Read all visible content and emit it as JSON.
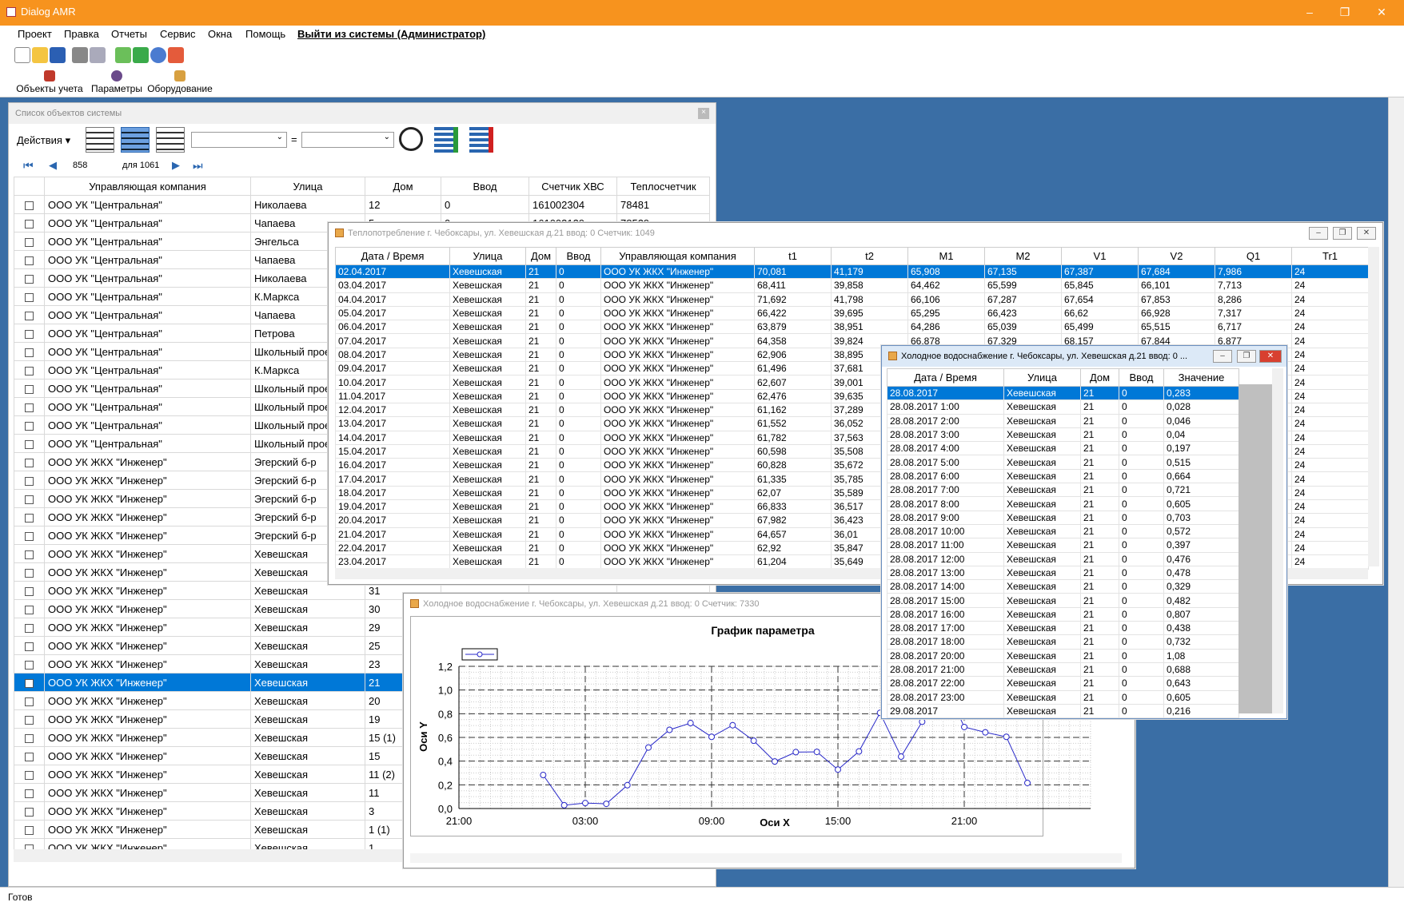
{
  "app": {
    "title": "Dialog AMR",
    "status": "Готов"
  },
  "menu": [
    "Проект",
    "Правка",
    "Отчеты",
    "Сервис",
    "Окна",
    "Помощь",
    "Выйти из системы (Администратор)"
  ],
  "ribbon": [
    "Объекты учета",
    "Параметры",
    "Оборудование"
  ],
  "objects_panel": {
    "title": "Список объектов системы",
    "actions": "Действия",
    "eq": "=",
    "record": "858",
    "of_label": "для 1061",
    "columns": [
      "Управляющая компания",
      "Улица",
      "Дом",
      "Ввод",
      "Счетчик ХВС",
      "Теплосчетчик"
    ],
    "rows": [
      [
        "ООО УК \"Центральная\"",
        "Николаева",
        "12",
        "0",
        "161002304",
        "78481"
      ],
      [
        "ООО УК \"Центральная\"",
        "Чапаева",
        "5",
        "0",
        "161003129",
        "78529"
      ],
      [
        "ООО УК \"Центральная\"",
        "Энгельса",
        "",
        "",
        "",
        ""
      ],
      [
        "ООО УК \"Центральная\"",
        "Чапаева",
        "",
        "",
        "",
        ""
      ],
      [
        "ООО УК \"Центральная\"",
        "Николаева",
        "",
        "",
        "",
        ""
      ],
      [
        "ООО УК \"Центральная\"",
        "К.Маркса",
        "",
        "",
        "",
        ""
      ],
      [
        "ООО УК \"Центральная\"",
        "Чапаева",
        "",
        "",
        "",
        ""
      ],
      [
        "ООО УК \"Центральная\"",
        "Петрова",
        "",
        "",
        "",
        ""
      ],
      [
        "ООО УК \"Центральная\"",
        "Школьный проезд",
        "",
        "",
        "",
        ""
      ],
      [
        "ООО УК \"Центральная\"",
        "К.Маркса",
        "",
        "",
        "",
        ""
      ],
      [
        "ООО УК \"Центральная\"",
        "Школьный проезд",
        "",
        "",
        "",
        ""
      ],
      [
        "ООО УК \"Центральная\"",
        "Школьный проезд",
        "",
        "",
        "",
        ""
      ],
      [
        "ООО УК \"Центральная\"",
        "Школьный проезд",
        "",
        "",
        "",
        ""
      ],
      [
        "ООО УК \"Центральная\"",
        "Школьный проезд",
        "",
        "",
        "",
        ""
      ],
      [
        "ООО УК ЖКХ \"Инженер\"",
        "Эгерский б-р",
        "",
        "",
        "",
        ""
      ],
      [
        "ООО УК ЖКХ \"Инженер\"",
        "Эгерский б-р",
        "",
        "",
        "",
        ""
      ],
      [
        "ООО УК ЖКХ \"Инженер\"",
        "Эгерский б-р",
        "",
        "",
        "",
        ""
      ],
      [
        "ООО УК ЖКХ \"Инженер\"",
        "Эгерский б-р",
        "",
        "",
        "",
        ""
      ],
      [
        "ООО УК ЖКХ \"Инженер\"",
        "Эгерский б-р",
        "",
        "",
        "",
        ""
      ],
      [
        "ООО УК ЖКХ \"Инженер\"",
        "Хевешская",
        "",
        "",
        "",
        ""
      ],
      [
        "ООО УК ЖКХ \"Инженер\"",
        "Хевешская",
        "",
        "",
        "",
        ""
      ],
      [
        "ООО УК ЖКХ \"Инженер\"",
        "Хевешская",
        "31",
        "",
        "",
        ""
      ],
      [
        "ООО УК ЖКХ \"Инженер\"",
        "Хевешская",
        "30",
        "",
        "",
        ""
      ],
      [
        "ООО УК ЖКХ \"Инженер\"",
        "Хевешская",
        "29",
        "",
        "",
        ""
      ],
      [
        "ООО УК ЖКХ \"Инженер\"",
        "Хевешская",
        "25",
        "",
        "",
        ""
      ],
      [
        "ООО УК ЖКХ \"Инженер\"",
        "Хевешская",
        "23",
        "",
        "",
        ""
      ],
      [
        "ООО УК ЖКХ \"Инженер\"",
        "Хевешская",
        "21",
        "",
        "",
        ""
      ],
      [
        "ООО УК ЖКХ \"Инженер\"",
        "Хевешская",
        "20",
        "",
        "",
        ""
      ],
      [
        "ООО УК ЖКХ \"Инженер\"",
        "Хевешская",
        "19",
        "",
        "",
        ""
      ],
      [
        "ООО УК ЖКХ \"Инженер\"",
        "Хевешская",
        "15 (1)",
        "",
        "",
        ""
      ],
      [
        "ООО УК ЖКХ \"Инженер\"",
        "Хевешская",
        "15",
        "",
        "",
        ""
      ],
      [
        "ООО УК ЖКХ \"Инженер\"",
        "Хевешская",
        "11 (2)",
        "",
        "",
        ""
      ],
      [
        "ООО УК ЖКХ \"Инженер\"",
        "Хевешская",
        "11",
        "",
        "",
        ""
      ],
      [
        "ООО УК ЖКХ \"Инженер\"",
        "Хевешская",
        "3",
        "",
        "",
        ""
      ],
      [
        "ООО УК ЖКХ \"Инженер\"",
        "Хевешская",
        "1 (1)",
        "",
        "",
        ""
      ],
      [
        "ООО УК ЖКХ \"Инженер\"",
        "Хевешская",
        "1",
        "",
        "",
        ""
      ]
    ],
    "selected": 26
  },
  "heat": {
    "title": "Теплопотребление г. Чебоксары, ул. Хевешская д.21 ввод: 0   Счетчик: 1049",
    "columns": [
      "Дата / Время",
      "Улица",
      "Дом",
      "Ввод",
      "Управляющая компания",
      "t1",
      "t2",
      "M1",
      "M2",
      "V1",
      "V2",
      "Q1",
      "Tr1"
    ],
    "rows": [
      [
        "02.04.2017",
        "70,081",
        "41,179",
        "65,908",
        "67,135",
        "67,387",
        "67,684",
        "7,986"
      ],
      [
        "03.04.2017",
        "68,411",
        "39,858",
        "64,462",
        "65,599",
        "65,845",
        "66,101",
        "7,713"
      ],
      [
        "04.04.2017",
        "71,692",
        "41,798",
        "66,106",
        "67,287",
        "67,654",
        "67,853",
        "8,286"
      ],
      [
        "05.04.2017",
        "66,422",
        "39,695",
        "65,295",
        "66,423",
        "66,62",
        "66,928",
        "7,317"
      ],
      [
        "06.04.2017",
        "63,879",
        "38,951",
        "64,286",
        "65,039",
        "65,499",
        "65,515",
        "6,717"
      ],
      [
        "07.04.2017",
        "64,358",
        "39,824",
        "66,878",
        "67,329",
        "68,157",
        "67,844",
        "6,877"
      ],
      [
        "08.04.2017",
        "62,906",
        "38,895",
        "",
        "",
        "",
        "",
        ""
      ],
      [
        "09.04.2017",
        "61,496",
        "37,681",
        "",
        "",
        "",
        "",
        ""
      ],
      [
        "10.04.2017",
        "62,607",
        "39,001",
        "",
        "",
        "",
        "",
        ""
      ],
      [
        "11.04.2017",
        "62,476",
        "39,635",
        "",
        "",
        "",
        "",
        ""
      ],
      [
        "12.04.2017",
        "61,162",
        "37,289",
        "",
        "",
        "",
        "",
        ""
      ],
      [
        "13.04.2017",
        "61,552",
        "36,052",
        "",
        "",
        "",
        "",
        ""
      ],
      [
        "14.04.2017",
        "61,782",
        "37,563",
        "",
        "",
        "",
        "",
        ""
      ],
      [
        "15.04.2017",
        "60,598",
        "35,508",
        "",
        "",
        "",
        "",
        ""
      ],
      [
        "16.04.2017",
        "60,828",
        "35,672",
        "",
        "",
        "",
        "",
        ""
      ],
      [
        "17.04.2017",
        "61,335",
        "35,785",
        "",
        "",
        "",
        "",
        ""
      ],
      [
        "18.04.2017",
        "62,07",
        "35,589",
        "",
        "",
        "",
        "",
        ""
      ],
      [
        "19.04.2017",
        "66,833",
        "36,517",
        "",
        "",
        "",
        "",
        ""
      ],
      [
        "20.04.2017",
        "67,982",
        "36,423",
        "",
        "",
        "",
        "",
        ""
      ],
      [
        "21.04.2017",
        "64,657",
        "36,01",
        "",
        "",
        "",
        "",
        ""
      ],
      [
        "22.04.2017",
        "62,92",
        "35,847",
        "",
        "",
        "",
        "",
        ""
      ],
      [
        "23.04.2017",
        "61,204",
        "35,649",
        "",
        "",
        "",
        "",
        ""
      ]
    ],
    "street": "Хевешская",
    "house": "21",
    "input": "0",
    "company": "ООО УК ЖКХ \"Инженер\"",
    "tr1": "24"
  },
  "cold_chart": {
    "title": "Холодное водоснабжение г. Чебоксары, ул. Хевешская д.21 ввод: 0   Счетчик: 7330"
  },
  "chart_data": {
    "type": "line",
    "title": "График параметра",
    "xlabel": "Оси X",
    "ylabel": "Оси Y",
    "ylim": [
      0,
      1.2
    ],
    "yticks": [
      "0,0",
      "0,2",
      "0,4",
      "0,6",
      "0,8",
      "1,0",
      "1,2"
    ],
    "xticks": [
      "21:00",
      "03:00",
      "09:00",
      "15:00",
      "21:00"
    ],
    "x_hours": [
      1,
      2,
      3,
      4,
      5,
      6,
      7,
      8,
      9,
      10,
      11,
      12,
      13,
      14,
      15,
      16,
      17,
      18,
      19,
      20,
      21,
      22,
      23,
      24
    ],
    "values": [
      0.283,
      0.028,
      0.046,
      0.04,
      0.197,
      0.515,
      0.664,
      0.721,
      0.605,
      0.703,
      0.572,
      0.397,
      0.476,
      0.478,
      0.329,
      0.482,
      0.807,
      0.438,
      0.732,
      1.08,
      0.688,
      0.643,
      0.605,
      0.216
    ]
  },
  "cold": {
    "title": "Холодное водоснабжение г. Чебоксары, ул. Хевешская д.21 ввод: 0 ...",
    "columns": [
      "Дата / Время",
      "Улица",
      "Дом",
      "Ввод",
      "Значение"
    ],
    "rows": [
      [
        "28.08.2017",
        "0,283"
      ],
      [
        "28.08.2017 1:00",
        "0,028"
      ],
      [
        "28.08.2017 2:00",
        "0,046"
      ],
      [
        "28.08.2017 3:00",
        "0,04"
      ],
      [
        "28.08.2017 4:00",
        "0,197"
      ],
      [
        "28.08.2017 5:00",
        "0,515"
      ],
      [
        "28.08.2017 6:00",
        "0,664"
      ],
      [
        "28.08.2017 7:00",
        "0,721"
      ],
      [
        "28.08.2017 8:00",
        "0,605"
      ],
      [
        "28.08.2017 9:00",
        "0,703"
      ],
      [
        "28.08.2017 10:00",
        "0,572"
      ],
      [
        "28.08.2017 11:00",
        "0,397"
      ],
      [
        "28.08.2017 12:00",
        "0,476"
      ],
      [
        "28.08.2017 13:00",
        "0,478"
      ],
      [
        "28.08.2017 14:00",
        "0,329"
      ],
      [
        "28.08.2017 15:00",
        "0,482"
      ],
      [
        "28.08.2017 16:00",
        "0,807"
      ],
      [
        "28.08.2017 17:00",
        "0,438"
      ],
      [
        "28.08.2017 18:00",
        "0,732"
      ],
      [
        "28.08.2017 20:00",
        "1,08"
      ],
      [
        "28.08.2017 21:00",
        "0,688"
      ],
      [
        "28.08.2017 22:00",
        "0,643"
      ],
      [
        "28.08.2017 23:00",
        "0,605"
      ],
      [
        "29.08.2017",
        "0,216"
      ]
    ]
  }
}
